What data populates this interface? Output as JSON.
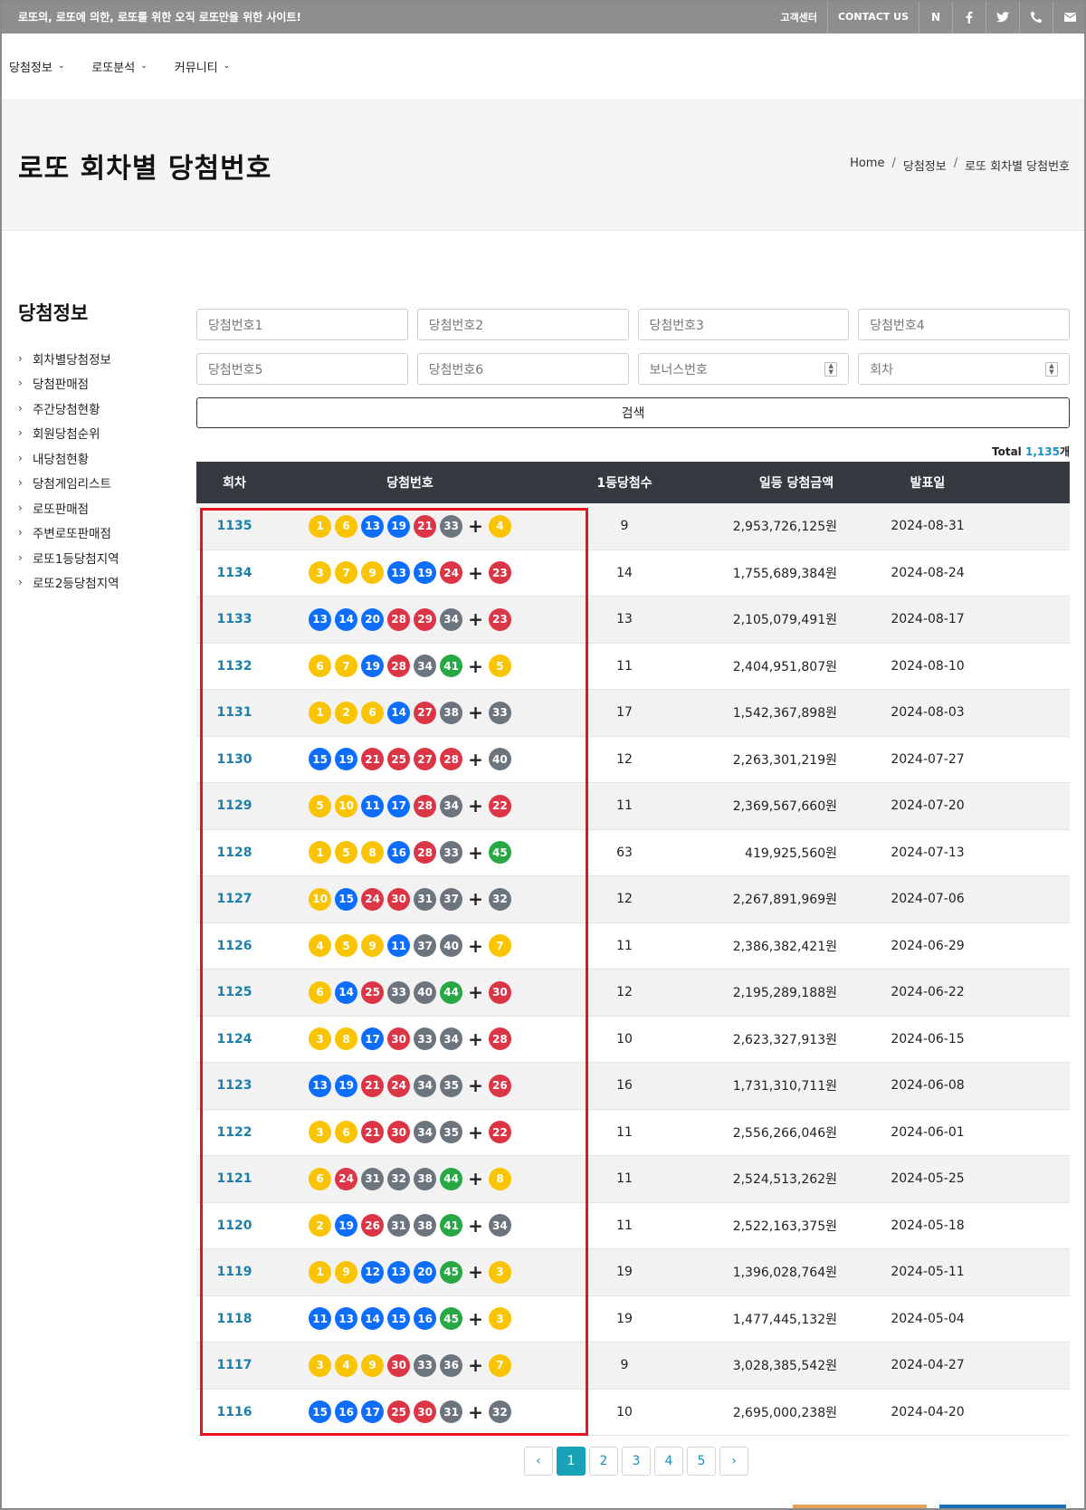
{
  "topbar": {
    "tagline": "로또의, 로또에 의한, 로또를 위한 오직 로또만을 위한 사이트!",
    "links": [
      "고객센터",
      "CONTACT US"
    ],
    "icons": [
      "naver-icon",
      "facebook-icon",
      "twitter-icon",
      "phone-icon",
      "mail-icon"
    ],
    "naver_label": "N"
  },
  "nav": {
    "items": [
      "당첨정보",
      "로또분석",
      "커뮤니티"
    ]
  },
  "header": {
    "title": "로또 회차별 당첨번호",
    "breadcrumb": [
      "Home",
      "당첨정보",
      "로또 회차별 당첨번호"
    ]
  },
  "sidebar": {
    "title": "당첨정보",
    "items": [
      "회차별당첨정보",
      "당첨판매점",
      "주간당첨현황",
      "회원당첨순위",
      "내당첨현황",
      "당첨게임리스트",
      "로또판매점",
      "주변로또판매점",
      "로또1등당첨지역",
      "로또2등당첨지역"
    ]
  },
  "search": {
    "placeholders": [
      "당첨번호1",
      "당첨번호2",
      "당첨번호3",
      "당첨번호4",
      "당첨번호5",
      "당첨번호6",
      "보너스번호",
      "회차"
    ],
    "button": "검색"
  },
  "total": {
    "label": "Total ",
    "count": "1,135",
    "unit": "개"
  },
  "table": {
    "headers": [
      "회차",
      "당첨번호",
      "1등당첨수",
      "일등 당첨금액",
      "발표일"
    ],
    "rows": [
      {
        "round": "1135",
        "nums": [
          1,
          6,
          13,
          19,
          21,
          33
        ],
        "bonus": 4,
        "winners": "9",
        "amount": "2,953,726,125원",
        "date": "2024-08-31"
      },
      {
        "round": "1134",
        "nums": [
          3,
          7,
          9,
          13,
          19,
          24
        ],
        "bonus": 23,
        "winners": "14",
        "amount": "1,755,689,384원",
        "date": "2024-08-24"
      },
      {
        "round": "1133",
        "nums": [
          13,
          14,
          20,
          28,
          29,
          34
        ],
        "bonus": 23,
        "winners": "13",
        "amount": "2,105,079,491원",
        "date": "2024-08-17"
      },
      {
        "round": "1132",
        "nums": [
          6,
          7,
          19,
          28,
          34,
          41
        ],
        "bonus": 5,
        "winners": "11",
        "amount": "2,404,951,807원",
        "date": "2024-08-10"
      },
      {
        "round": "1131",
        "nums": [
          1,
          2,
          6,
          14,
          27,
          38
        ],
        "bonus": 33,
        "winners": "17",
        "amount": "1,542,367,898원",
        "date": "2024-08-03"
      },
      {
        "round": "1130",
        "nums": [
          15,
          19,
          21,
          25,
          27,
          28
        ],
        "bonus": 40,
        "winners": "12",
        "amount": "2,263,301,219원",
        "date": "2024-07-27"
      },
      {
        "round": "1129",
        "nums": [
          5,
          10,
          11,
          17,
          28,
          34
        ],
        "bonus": 22,
        "winners": "11",
        "amount": "2,369,567,660원",
        "date": "2024-07-20"
      },
      {
        "round": "1128",
        "nums": [
          1,
          5,
          8,
          16,
          28,
          33
        ],
        "bonus": 45,
        "winners": "63",
        "amount": "419,925,560원",
        "date": "2024-07-13"
      },
      {
        "round": "1127",
        "nums": [
          10,
          15,
          24,
          30,
          31,
          37
        ],
        "bonus": 32,
        "winners": "12",
        "amount": "2,267,891,969원",
        "date": "2024-07-06"
      },
      {
        "round": "1126",
        "nums": [
          4,
          5,
          9,
          11,
          37,
          40
        ],
        "bonus": 7,
        "winners": "11",
        "amount": "2,386,382,421원",
        "date": "2024-06-29"
      },
      {
        "round": "1125",
        "nums": [
          6,
          14,
          25,
          33,
          40,
          44
        ],
        "bonus": 30,
        "winners": "12",
        "amount": "2,195,289,188원",
        "date": "2024-06-22"
      },
      {
        "round": "1124",
        "nums": [
          3,
          8,
          17,
          30,
          33,
          34
        ],
        "bonus": 28,
        "winners": "10",
        "amount": "2,623,327,913원",
        "date": "2024-06-15"
      },
      {
        "round": "1123",
        "nums": [
          13,
          19,
          21,
          24,
          34,
          35
        ],
        "bonus": 26,
        "winners": "16",
        "amount": "1,731,310,711원",
        "date": "2024-06-08"
      },
      {
        "round": "1122",
        "nums": [
          3,
          6,
          21,
          30,
          34,
          35
        ],
        "bonus": 22,
        "winners": "11",
        "amount": "2,556,266,046원",
        "date": "2024-06-01"
      },
      {
        "round": "1121",
        "nums": [
          6,
          24,
          31,
          32,
          38,
          44
        ],
        "bonus": 8,
        "winners": "11",
        "amount": "2,524,513,262원",
        "date": "2024-05-25"
      },
      {
        "round": "1120",
        "nums": [
          2,
          19,
          26,
          31,
          38,
          41
        ],
        "bonus": 34,
        "winners": "11",
        "amount": "2,522,163,375원",
        "date": "2024-05-18"
      },
      {
        "round": "1119",
        "nums": [
          1,
          9,
          12,
          13,
          20,
          45
        ],
        "bonus": 3,
        "winners": "19",
        "amount": "1,396,028,764원",
        "date": "2024-05-11"
      },
      {
        "round": "1118",
        "nums": [
          11,
          13,
          14,
          15,
          16,
          45
        ],
        "bonus": 3,
        "winners": "19",
        "amount": "1,477,445,132원",
        "date": "2024-05-04"
      },
      {
        "round": "1117",
        "nums": [
          3,
          4,
          9,
          30,
          33,
          36
        ],
        "bonus": 7,
        "winners": "9",
        "amount": "3,028,385,542원",
        "date": "2024-04-27"
      },
      {
        "round": "1116",
        "nums": [
          15,
          16,
          17,
          25,
          30,
          31
        ],
        "bonus": 32,
        "winners": "10",
        "amount": "2,695,000,238원",
        "date": "2024-04-20"
      }
    ]
  },
  "pagination": {
    "prev": "‹",
    "pages": [
      "1",
      "2",
      "3",
      "4",
      "5"
    ],
    "active": "1",
    "next": "›"
  },
  "colors": {
    "yellow": "#fbc400",
    "blue": "#0d6efd",
    "red": "#dc3545",
    "gray": "#6c757d",
    "green": "#28a745",
    "accent": "#17a2b8"
  }
}
